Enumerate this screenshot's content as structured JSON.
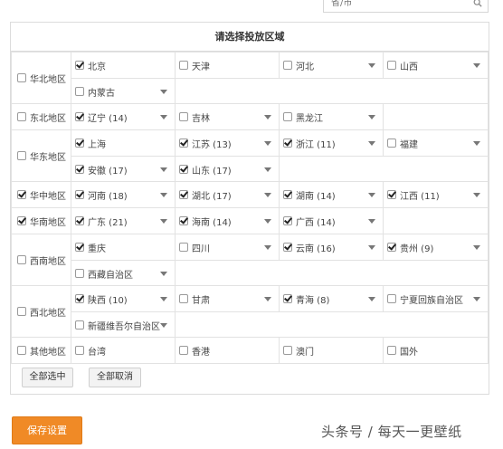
{
  "search": {
    "placeholder": "省/市"
  },
  "panel": {
    "title": "请选择投放区域"
  },
  "regions": [
    {
      "name": "华北地区",
      "checked": false,
      "rows": [
        [
          {
            "label": "北京",
            "checked": true,
            "dropdown": false
          },
          {
            "label": "天津",
            "checked": false,
            "dropdown": false
          },
          {
            "label": "河北",
            "checked": false,
            "dropdown": true
          },
          {
            "label": "山西",
            "checked": false,
            "dropdown": true
          }
        ],
        [
          {
            "label": "内蒙古",
            "checked": false,
            "dropdown": true
          }
        ]
      ]
    },
    {
      "name": "东北地区",
      "checked": false,
      "rows": [
        [
          {
            "label": "辽宁 (14)",
            "checked": true,
            "dropdown": true
          },
          {
            "label": "吉林",
            "checked": false,
            "dropdown": true
          },
          {
            "label": "黑龙江",
            "checked": false,
            "dropdown": true
          }
        ]
      ]
    },
    {
      "name": "华东地区",
      "checked": false,
      "rows": [
        [
          {
            "label": "上海",
            "checked": true,
            "dropdown": false
          },
          {
            "label": "江苏 (13)",
            "checked": true,
            "dropdown": true
          },
          {
            "label": "浙江 (11)",
            "checked": true,
            "dropdown": true
          },
          {
            "label": "福建",
            "checked": false,
            "dropdown": true
          }
        ],
        [
          {
            "label": "安徽 (17)",
            "checked": true,
            "dropdown": true
          },
          {
            "label": "山东 (17)",
            "checked": true,
            "dropdown": true
          }
        ]
      ]
    },
    {
      "name": "华中地区",
      "checked": true,
      "rows": [
        [
          {
            "label": "河南 (18)",
            "checked": true,
            "dropdown": true
          },
          {
            "label": "湖北 (17)",
            "checked": true,
            "dropdown": true
          },
          {
            "label": "湖南 (14)",
            "checked": true,
            "dropdown": true
          },
          {
            "label": "江西 (11)",
            "checked": true,
            "dropdown": true
          }
        ]
      ]
    },
    {
      "name": "华南地区",
      "checked": true,
      "rows": [
        [
          {
            "label": "广东 (21)",
            "checked": true,
            "dropdown": true
          },
          {
            "label": "海南 (14)",
            "checked": true,
            "dropdown": true
          },
          {
            "label": "广西 (14)",
            "checked": true,
            "dropdown": true
          }
        ]
      ]
    },
    {
      "name": "西南地区",
      "checked": false,
      "rows": [
        [
          {
            "label": "重庆",
            "checked": true,
            "dropdown": false
          },
          {
            "label": "四川",
            "checked": false,
            "dropdown": true
          },
          {
            "label": "云南 (16)",
            "checked": true,
            "dropdown": true
          },
          {
            "label": "贵州 (9)",
            "checked": true,
            "dropdown": true
          }
        ],
        [
          {
            "label": "西藏自治区",
            "checked": false,
            "dropdown": true
          }
        ]
      ]
    },
    {
      "name": "西北地区",
      "checked": false,
      "rows": [
        [
          {
            "label": "陕西 (10)",
            "checked": true,
            "dropdown": true
          },
          {
            "label": "甘肃",
            "checked": false,
            "dropdown": true
          },
          {
            "label": "青海 (8)",
            "checked": true,
            "dropdown": true
          },
          {
            "label": "宁夏回族自治区",
            "checked": false,
            "dropdown": true
          }
        ],
        [
          {
            "label": "新疆维吾尔自治区",
            "checked": false,
            "dropdown": true
          }
        ]
      ]
    },
    {
      "name": "其他地区",
      "checked": false,
      "rows": [
        [
          {
            "label": "台湾",
            "checked": false,
            "dropdown": false
          },
          {
            "label": "香港",
            "checked": false,
            "dropdown": false
          },
          {
            "label": "澳门",
            "checked": false,
            "dropdown": false
          },
          {
            "label": "国外",
            "checked": false,
            "dropdown": false
          }
        ]
      ]
    }
  ],
  "buttons": {
    "select_all": "全部选中",
    "clear_all": "全部取消",
    "save": "保存设置"
  },
  "watermark": "头条号 / 每天一更壁纸",
  "colors": {
    "save_button": "#f08a26",
    "border": "#dcdcdc"
  }
}
